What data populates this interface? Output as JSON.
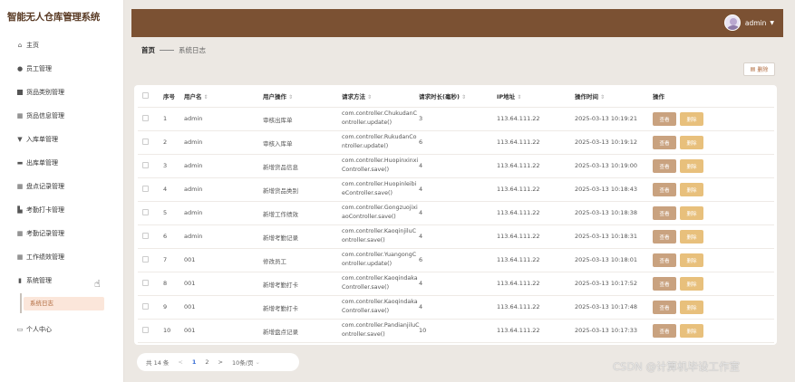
{
  "app_title": "智能无人仓库管理系统",
  "sidebar": {
    "items": [
      {
        "label": "主页",
        "icon": "home-icon"
      },
      {
        "label": "员工管理",
        "icon": "person-icon"
      },
      {
        "label": "货品类别管理",
        "icon": "list-icon"
      },
      {
        "label": "货品信息管理",
        "icon": "grid-icon"
      },
      {
        "label": "入库单管理",
        "icon": "shield-icon"
      },
      {
        "label": "出库单管理",
        "icon": "truck-icon"
      },
      {
        "label": "盘点记录管理",
        "icon": "grid-icon"
      },
      {
        "label": "考勤打卡管理",
        "icon": "chart-icon"
      },
      {
        "label": "考勤记录管理",
        "icon": "grid-icon"
      },
      {
        "label": "工作绩效管理",
        "icon": "grid-icon"
      },
      {
        "label": "系统管理",
        "icon": "trash-icon"
      },
      {
        "label": "个人中心",
        "icon": "monitor-icon"
      }
    ],
    "sub_item": "系统日志"
  },
  "header": {
    "username": "admin"
  },
  "breadcrumb": {
    "home": "首页",
    "current": "系统日志"
  },
  "toolbar": {
    "delete_label": "删除"
  },
  "table": {
    "columns": [
      "序号",
      "用户名",
      "用户操作",
      "请求方法",
      "请求时长(毫秒)",
      "IP地址",
      "操作时间",
      "操作"
    ],
    "view_label": "查看",
    "delete_label": "删除",
    "rows": [
      {
        "no": "1",
        "user": "admin",
        "op": "审核出库单",
        "method_1": "com.controller.ChukudanC",
        "method_2": "ontroller.update()",
        "dur": "3",
        "ip": "113.64.111.22",
        "time": "2025-03-13 10:19:21"
      },
      {
        "no": "2",
        "user": "admin",
        "op": "审核入库单",
        "method_1": "com.controller.RukudanCo",
        "method_2": "ntroller.update()",
        "dur": "6",
        "ip": "113.64.111.22",
        "time": "2025-03-13 10:19:12"
      },
      {
        "no": "3",
        "user": "admin",
        "op": "新增货品信息",
        "method_1": "com.controller.Huopinxinxi",
        "method_2": "Controller.save()",
        "dur": "4",
        "ip": "113.64.111.22",
        "time": "2025-03-13 10:19:00"
      },
      {
        "no": "4",
        "user": "admin",
        "op": "新增货品类别",
        "method_1": "com.controller.Huopinleibi",
        "method_2": "eController.save()",
        "dur": "4",
        "ip": "113.64.111.22",
        "time": "2025-03-13 10:18:43"
      },
      {
        "no": "5",
        "user": "admin",
        "op": "新增工作绩效",
        "method_1": "com.controller.Gongzuojixi",
        "method_2": "aoController.save()",
        "dur": "4",
        "ip": "113.64.111.22",
        "time": "2025-03-13 10:18:38"
      },
      {
        "no": "6",
        "user": "admin",
        "op": "新增考勤记录",
        "method_1": "com.controller.KaoqinjiluC",
        "method_2": "ontroller.save()",
        "dur": "4",
        "ip": "113.64.111.22",
        "time": "2025-03-13 10:18:31"
      },
      {
        "no": "7",
        "user": "001",
        "op": "修改员工",
        "method_1": "com.controller.YuangongC",
        "method_2": "ontroller.update()",
        "dur": "6",
        "ip": "113.64.111.22",
        "time": "2025-03-13 10:18:01"
      },
      {
        "no": "8",
        "user": "001",
        "op": "新增考勤打卡",
        "method_1": "com.controller.Kaoqindaka",
        "method_2": "Controller.save()",
        "dur": "4",
        "ip": "113.64.111.22",
        "time": "2025-03-13 10:17:52"
      },
      {
        "no": "9",
        "user": "001",
        "op": "新增考勤打卡",
        "method_1": "com.controller.Kaoqindaka",
        "method_2": "Controller.save()",
        "dur": "4",
        "ip": "113.64.111.22",
        "time": "2025-03-13 10:17:48"
      },
      {
        "no": "10",
        "user": "001",
        "op": "新增盘点记录",
        "method_1": "com.controller.PandianjiluC",
        "method_2": "ontroller.save()",
        "dur": "10",
        "ip": "113.64.111.22",
        "time": "2025-03-13 10:17:33"
      }
    ]
  },
  "pagination": {
    "total": "共 14 条",
    "prev": "<",
    "page1": "1",
    "page2": "2",
    "next": ">",
    "page_size": "10条/页"
  },
  "watermark": "CSDN @计算机毕设工作室",
  "colors": {
    "accent": "#7b5133",
    "view_button": "#c9a27f",
    "delete_button": "#e8c07c",
    "active_sub": "#fbe6da"
  }
}
